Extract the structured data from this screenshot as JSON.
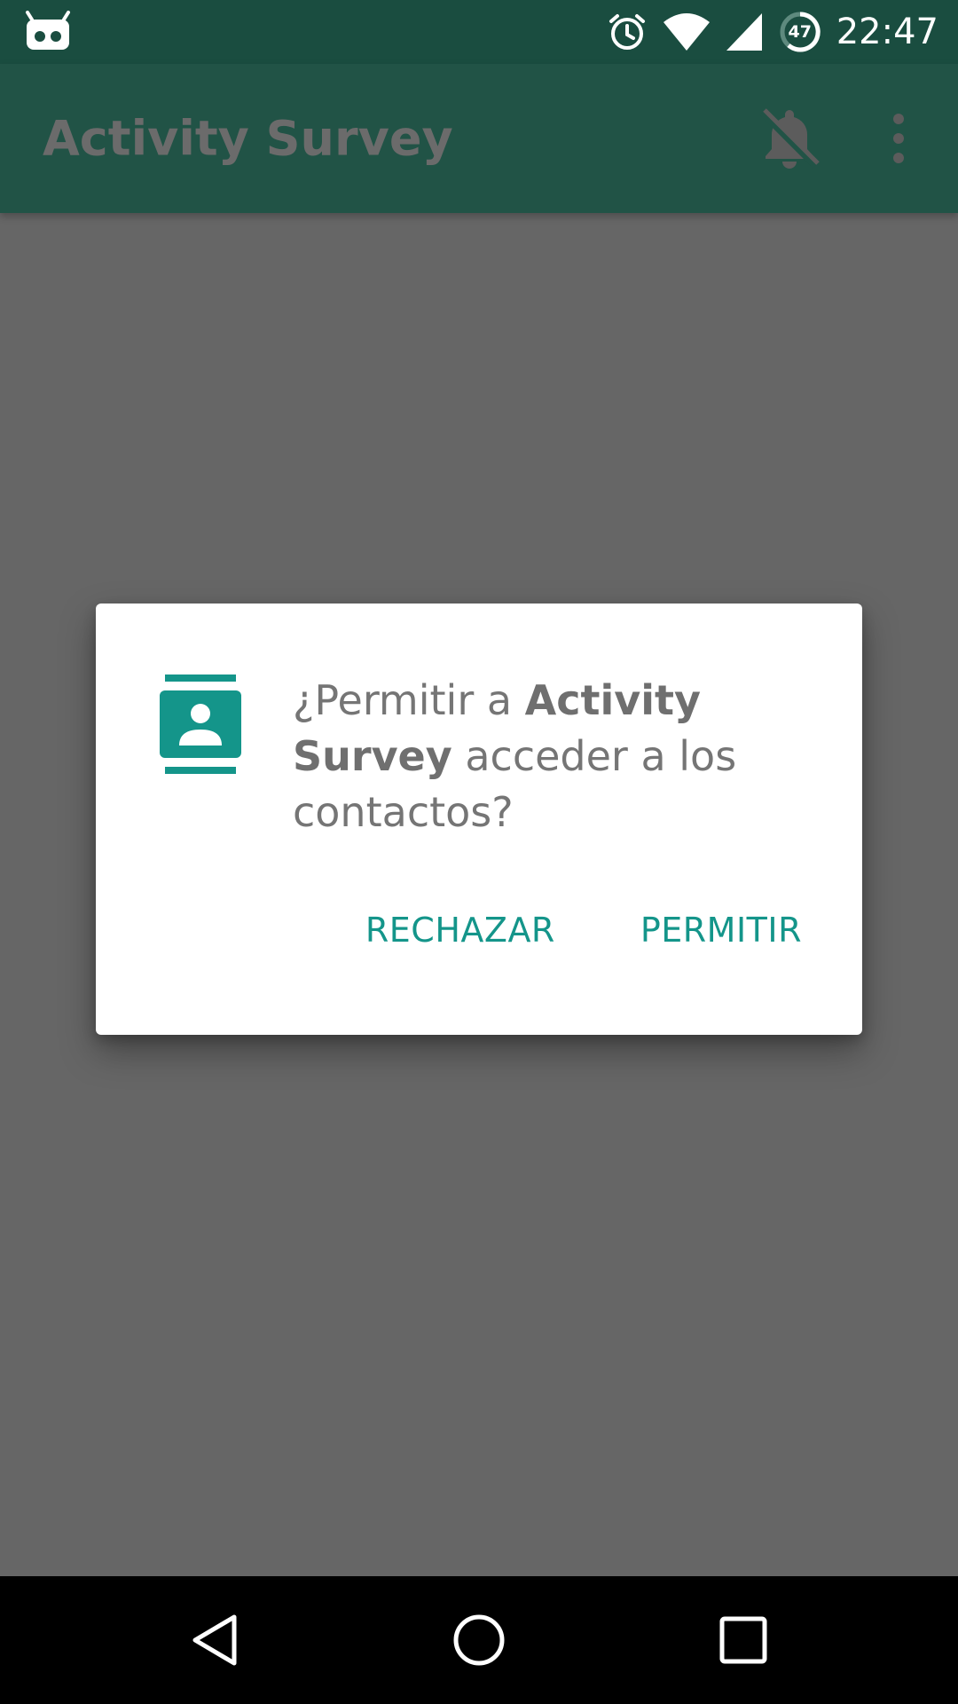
{
  "status_bar": {
    "time": "22:47",
    "battery_level": "47",
    "icons": [
      "cyanogen-mod-icon",
      "alarm-icon",
      "wifi-icon",
      "cell-signal-icon",
      "battery-icon"
    ]
  },
  "app_bar": {
    "title": "Activity Survey",
    "icons": [
      "notifications-off-icon",
      "more-vert-icon"
    ]
  },
  "dialog": {
    "icon": "contacts-icon",
    "message_prefix": "¿Permitir a ",
    "app_name_line1": "Activity",
    "app_name_line2": "Survey",
    "message_suffix": " acceder a los contactos?",
    "deny_label": "RECHAZAR",
    "allow_label": "PERMITIR"
  },
  "nav_bar": {
    "icons": [
      "back-icon",
      "home-icon",
      "recents-icon"
    ]
  },
  "colors": {
    "status_bar": "#1A4D40",
    "app_bar": "#215346",
    "scrim": "#666666",
    "accent": "#14958A",
    "dialog_bg": "#FFFFFF"
  }
}
